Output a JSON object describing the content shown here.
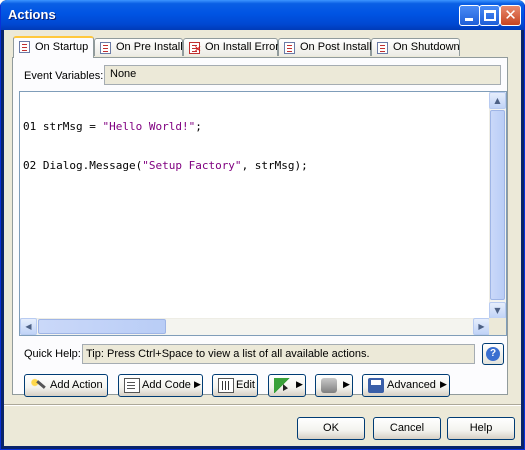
{
  "window": {
    "title": "Actions"
  },
  "tabs": [
    {
      "label": "On Startup",
      "active": true,
      "icon": "script-icon"
    },
    {
      "label": "On Pre Install",
      "active": false,
      "icon": "script-icon"
    },
    {
      "label": "On Install Error",
      "active": false,
      "icon": "script-error-icon"
    },
    {
      "label": "On Post Install",
      "active": false,
      "icon": "script-icon"
    },
    {
      "label": "On Shutdown",
      "active": false,
      "icon": "script-icon"
    }
  ],
  "event_variables": {
    "label": "Event Variables:",
    "value": "None"
  },
  "editor": {
    "lines": [
      {
        "num": "01",
        "code_a": "strMsg = ",
        "code_b": "\"Hello World!\"",
        "code_c": ";"
      },
      {
        "num": "02",
        "code_a": "Dialog.Message(",
        "code_b": "\"Setup Factory\"",
        "code_c": ", strMsg);"
      }
    ]
  },
  "quick_help": {
    "label": "Quick Help:",
    "text": "Tip: Press Ctrl+Space to view a list of all available actions."
  },
  "toolbar": {
    "add_action": "Add Action",
    "add_code": "Add Code",
    "edit": "Edit",
    "advanced": "Advanced"
  },
  "dialog_buttons": {
    "ok": "OK",
    "cancel": "Cancel",
    "help": "Help"
  }
}
